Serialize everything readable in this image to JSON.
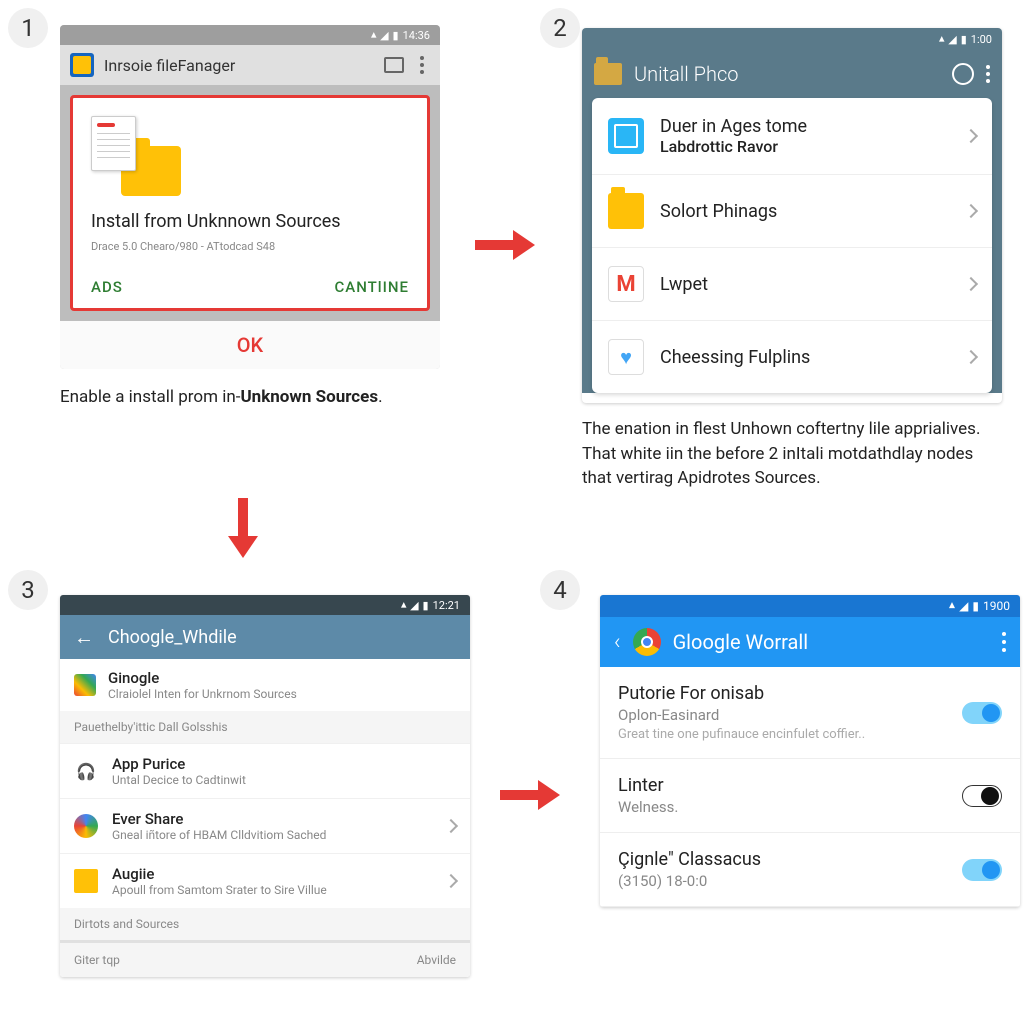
{
  "steps": {
    "s1": "1",
    "s2": "2",
    "s3": "3",
    "s4": "4"
  },
  "panel1": {
    "status_time": "14:36",
    "app_title": "Inrsoie fileFanager",
    "dialog_heading": "Install from Unknnown Sources",
    "dialog_sub": "Drace 5.0 Chearo/980 - ATtodcad S48",
    "btn_left": "ADS",
    "btn_right": "CANTlINE",
    "ok": "OK",
    "caption_pre": "Enable a install prom in-",
    "caption_bold": "Unknown Sources",
    "caption_post": "."
  },
  "panel2": {
    "status_time": "1:00",
    "app_title": "Unitall Phco",
    "items": [
      {
        "title": "Duer in Ages tome",
        "subtitle": "Labdrottic Ravor"
      },
      {
        "title": "Solort Phinags"
      },
      {
        "title": "Lwpet"
      },
      {
        "title": "Cheessing Fulplins"
      }
    ],
    "caption": "The enation in flest Unhown coftertny lile apprialives. That white iin the before 2 inItali motdathdlay nodes that vertirag Apidrotes Sources."
  },
  "panel3": {
    "status_time": "12:21",
    "app_title": "Choogle_Whdile",
    "head_title": "Ginogle",
    "head_sub": "Clraiolel Inten for Unkrnom Sources",
    "section1": "Pauethelby'ittic Dall Golsshis",
    "rows": [
      {
        "t": "App Purice",
        "s": "Untal Decice to Cadtinwit"
      },
      {
        "t": "Ever Share",
        "s": "Gneal iñtore of HBAM Clldvitiom Sached"
      },
      {
        "t": "Augiie",
        "s": "Apoull from Samtom Srater to Sire Villue"
      }
    ],
    "section2": "Dirtots and Sources",
    "footer_left": "Giter tqp",
    "footer_right": "Abvilde"
  },
  "panel4": {
    "status_time": "1900",
    "app_title": "Gloogle Worrall",
    "items": [
      {
        "t": "Putorie For onisab",
        "s": "Oplon-Easinard",
        "d": "Great tine one pufinauce encinfulet coffier.."
      },
      {
        "t": "Linter",
        "s": "Welness."
      },
      {
        "t": "Çignle\" Classacus",
        "s": "(3150) 18-0:0"
      }
    ]
  }
}
